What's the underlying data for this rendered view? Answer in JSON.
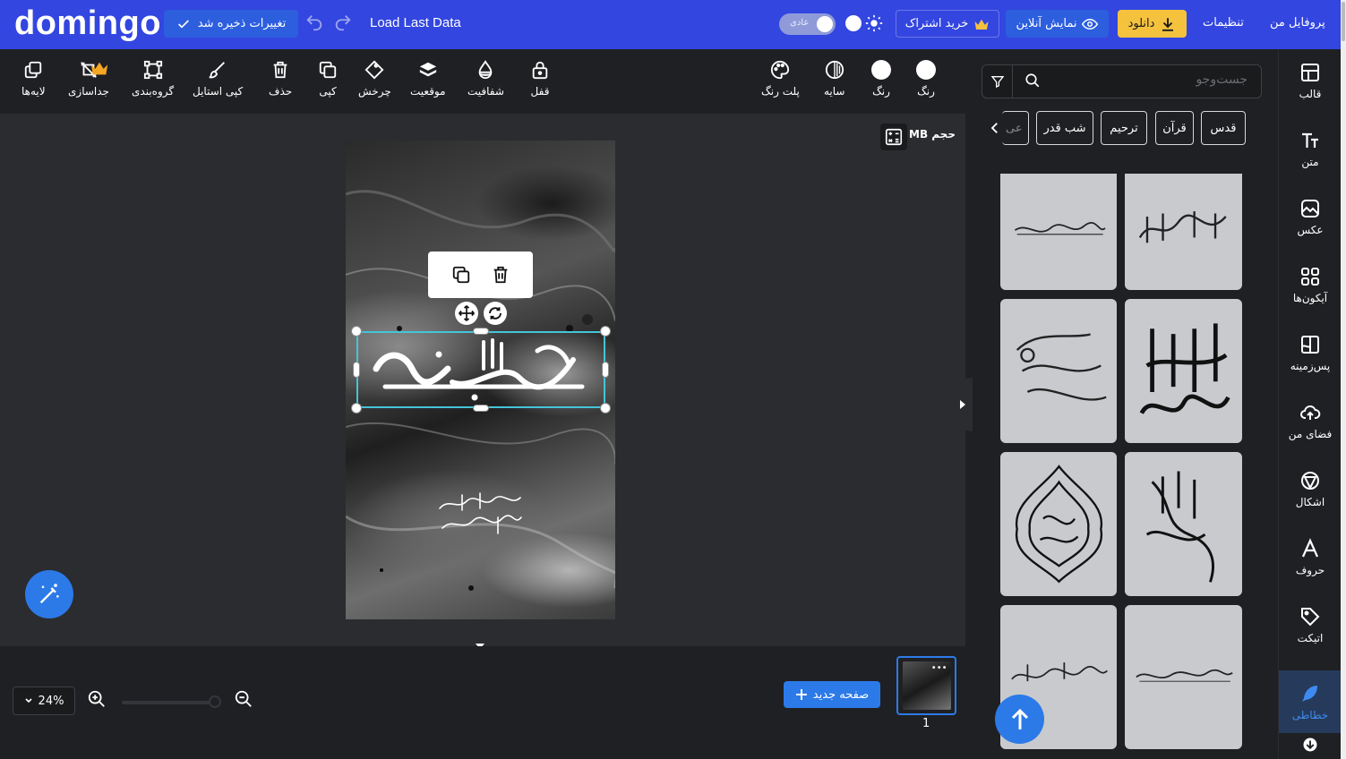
{
  "topbar": {
    "logo": "domingo",
    "saved_label": "تغییرات ذخیره شد",
    "load_last": "Load Last Data",
    "mode_label": "عادی",
    "subscribe_label": "خرید اشتراک",
    "online_label": "نمایش آنلاین",
    "download_label": "دانلود",
    "settings_label": "تنظیمات",
    "profile_label": "پروفایل من"
  },
  "toolbar": {
    "layers": "لایه‌ها",
    "separate": "جداسازی",
    "group": "گروه‌بندی",
    "copy_style": "کپی استایل",
    "delete": "حذف",
    "copy": "کپی",
    "rotate": "چرخش",
    "position": "موقعیت",
    "opacity": "شفافیت",
    "lock": "قفل",
    "palette": "پلت رنگ",
    "shadow": "سایه",
    "color1": "رنگ",
    "color2": "رنگ"
  },
  "canvas": {
    "size_label": "حجم MB"
  },
  "bottom": {
    "zoom": "24%",
    "new_page": "صفحه جدید",
    "page_number": "1"
  },
  "panel": {
    "search_placeholder": "جست‌وجو",
    "chips": [
      "قدس",
      "قرآن",
      "ترحیم",
      "شب قدر",
      "عی"
    ]
  },
  "sidebar": {
    "items": [
      {
        "label": "قالب",
        "icon": "template-icon"
      },
      {
        "label": "متن",
        "icon": "text-icon"
      },
      {
        "label": "عکس",
        "icon": "image-icon"
      },
      {
        "label": "آیکون‌ها",
        "icon": "icons-grid-icon"
      },
      {
        "label": "پس‌زمینه",
        "icon": "background-icon"
      },
      {
        "label": "فضای من",
        "icon": "cloud-upload-icon"
      },
      {
        "label": "اشکال",
        "icon": "shapes-icon"
      },
      {
        "label": "حروف",
        "icon": "letters-icon"
      },
      {
        "label": "اتیکت",
        "icon": "tag-icon"
      },
      {
        "label": "خطاطی",
        "icon": "feather-icon"
      }
    ]
  },
  "colors": {
    "brand": "#3346e0",
    "accent": "#2c7ae8",
    "download": "#f5c23e",
    "selection": "#45c5d8",
    "panel_bg": "#1f2023"
  }
}
